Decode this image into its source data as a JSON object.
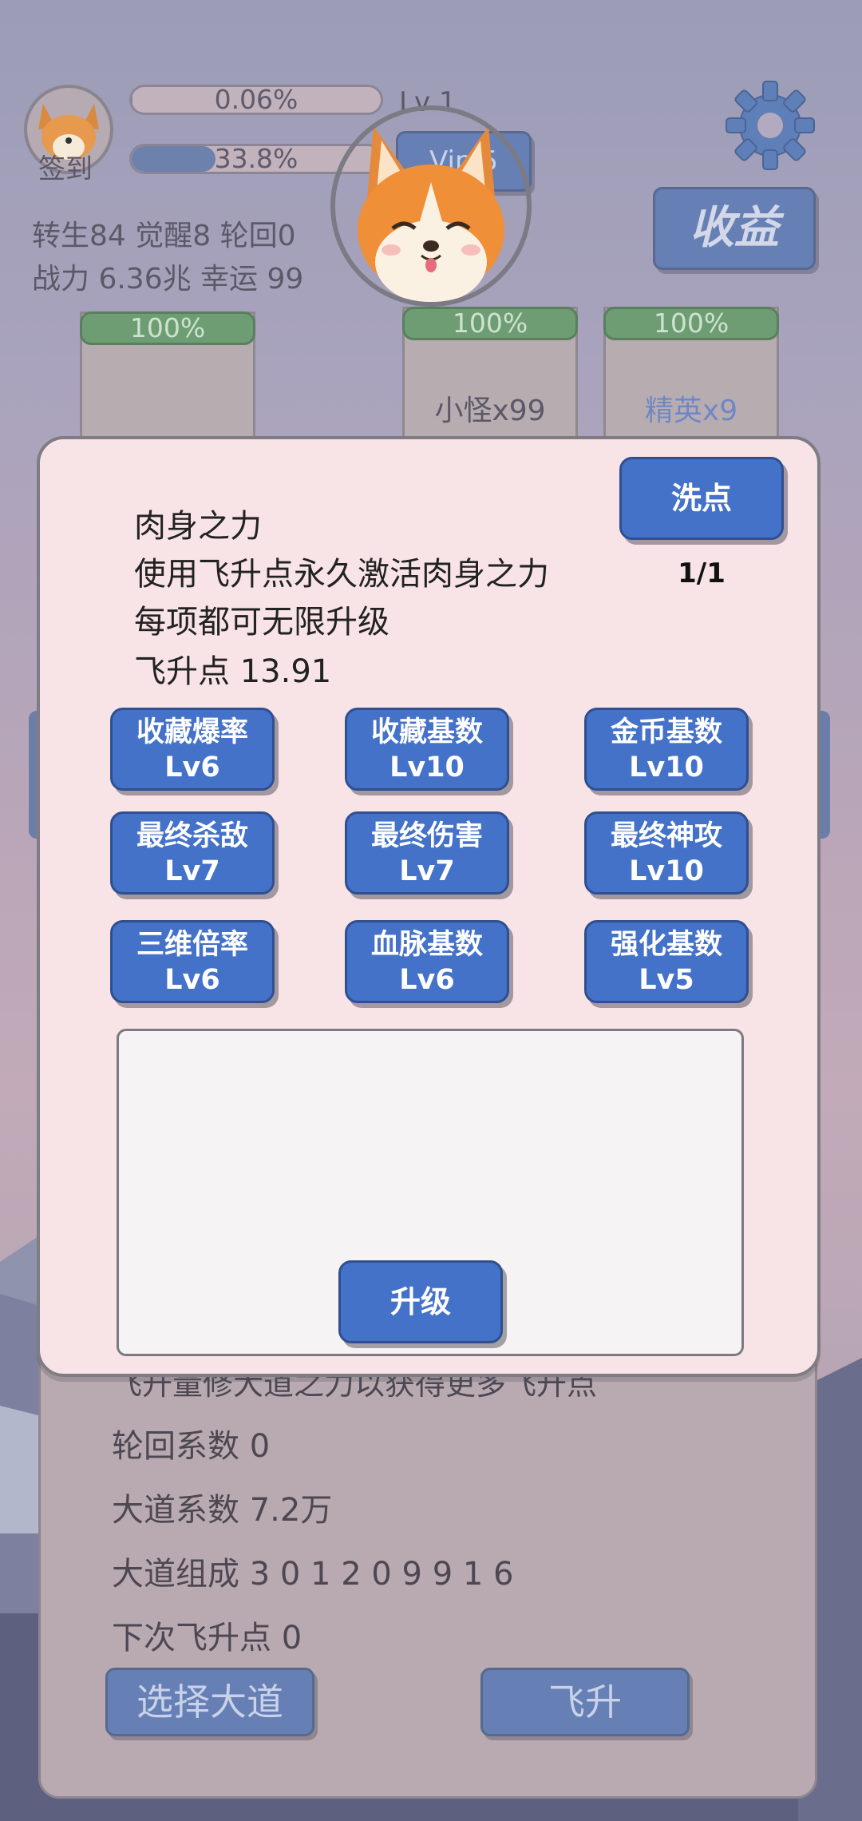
{
  "header": {
    "exp_bar": {
      "text": "0.06%",
      "progress": 0.0006
    },
    "level_label": "Lv 1",
    "second_bar": {
      "text": "33.8%",
      "progress": 0.338
    },
    "vip_label": "Vip 5",
    "sign_in_label": "签到",
    "stats_line1": "转生84 觉醒8 轮回0",
    "stats_line2": "战力 6.36兆  幸运 99",
    "income_label": "收益"
  },
  "slots": [
    {
      "percent": "100%",
      "label": ""
    },
    {
      "percent": "100%",
      "label": "小怪x99"
    },
    {
      "percent": "100%",
      "label": "精英x9"
    }
  ],
  "background_panel": {
    "partial_line": "飞升量修大道之力以获得更多飞升点",
    "lines": [
      "轮回系数 0",
      "大道系数 7.2万",
      "大道组成 3 0 1 2 0 9 9 1 6",
      "下次飞升点 0"
    ],
    "choose_path_label": "选择大道",
    "ascend_label": "飞升"
  },
  "dialog": {
    "title": "肉身之力",
    "desc1": "使用飞升点永久激活肉身之力",
    "desc2": "每项都可无限升级",
    "points": "飞升点 13.91",
    "reset_label": "洗点",
    "page_indicator": "1/1",
    "upgrades": [
      {
        "name": "收藏爆率",
        "level": "Lv6"
      },
      {
        "name": "收藏基数",
        "level": "Lv10"
      },
      {
        "name": "金币基数",
        "level": "Lv10"
      },
      {
        "name": "最终杀敌",
        "level": "Lv7"
      },
      {
        "name": "最终伤害",
        "level": "Lv7"
      },
      {
        "name": "最终神攻",
        "level": "Lv10"
      },
      {
        "name": "三维倍率",
        "level": "Lv6"
      },
      {
        "name": "血脉基数",
        "level": "Lv6"
      },
      {
        "name": "强化基数",
        "level": "Lv5"
      }
    ],
    "upgrade_label": "升级"
  },
  "colors": {
    "accent": "#4472c9",
    "dialog_bg": "#f8e4e7",
    "progress_green": "#6e9d74"
  }
}
